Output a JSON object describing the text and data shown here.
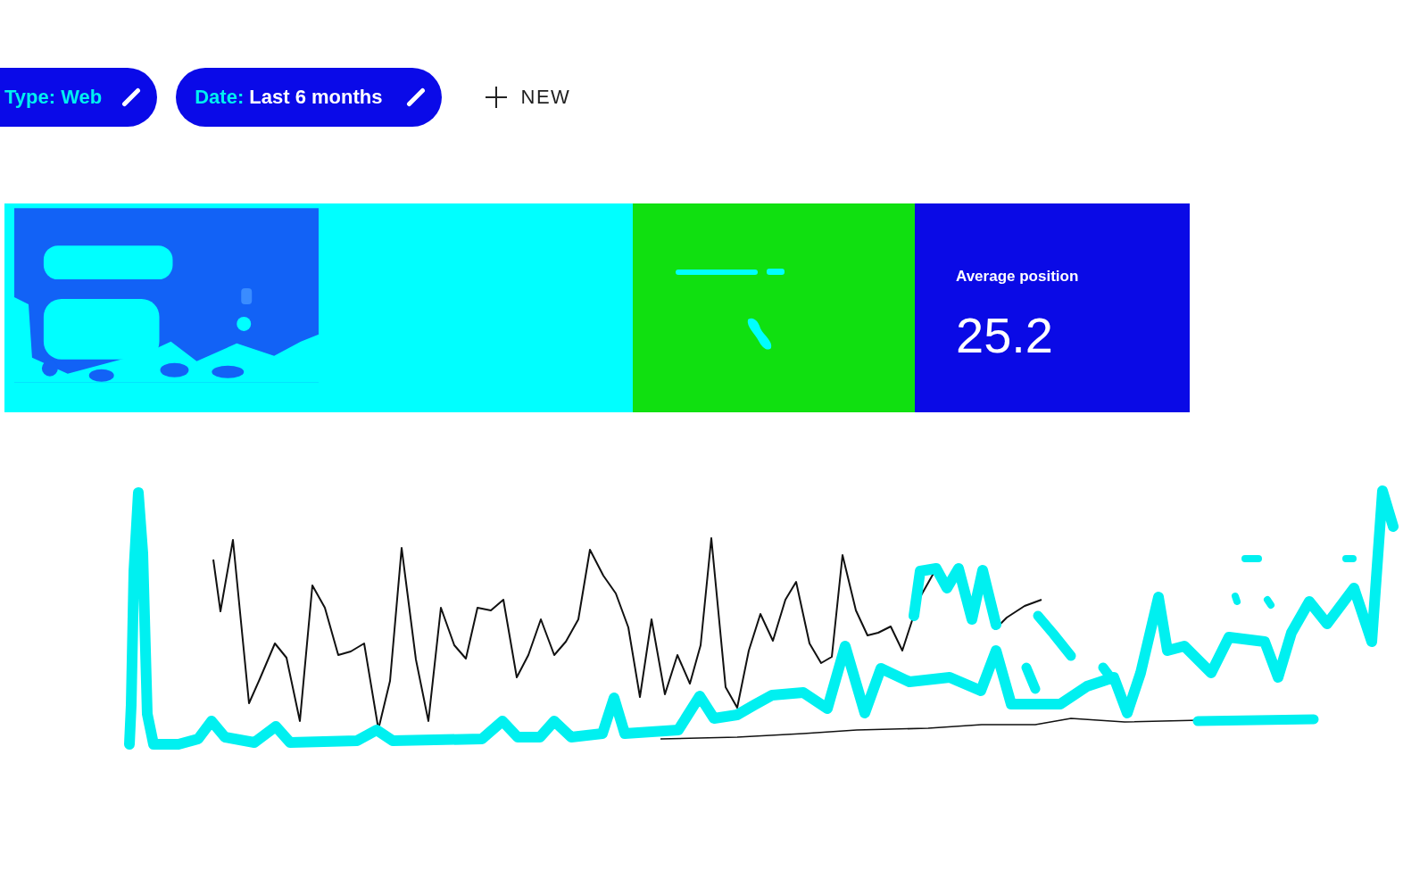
{
  "filters": [
    {
      "label": "Type:",
      "value": "Web"
    },
    {
      "label": "Date:",
      "value": "Last 6 months"
    }
  ],
  "new_button": {
    "label": "NEW"
  },
  "cards": [
    {
      "kind": "blurred",
      "color": "#00ffff"
    },
    {
      "kind": "blank",
      "color": "#00ffff"
    },
    {
      "kind": "smudged",
      "color": "#10e010"
    },
    {
      "kind": "metric",
      "color": "#0a0ae6",
      "label": "Average position",
      "value": "25.2"
    }
  ]
}
